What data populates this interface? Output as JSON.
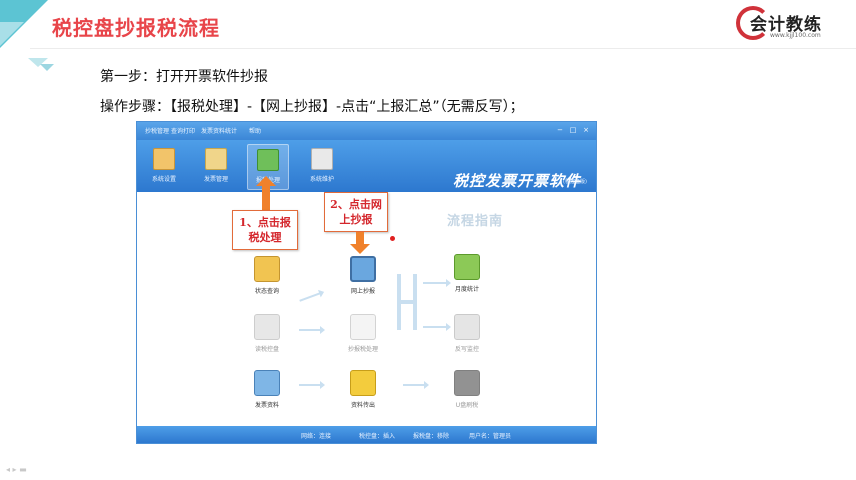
{
  "slide": {
    "title": "税控盘抄报税流程",
    "logo_text": "会计教练",
    "logo_url": "www.kjjl100.com",
    "step1": "第一步：打开开票软件抄报",
    "step2": "操作步骤：【报税处理】-【网上抄报】-点击“上报汇总”（无需反写）；"
  },
  "window": {
    "menu": [
      "抄税管理",
      "查询打印",
      "发票资料统计",
      "帮助"
    ],
    "win_controls": [
      "−",
      "□",
      "×"
    ],
    "toolbar": [
      {
        "label": "系统设置",
        "color": "#f2c46a"
      },
      {
        "label": "发票管理",
        "color": "#f0d58a"
      },
      {
        "label": "报税处理",
        "color": "#6fbf5a"
      },
      {
        "label": "系统维护",
        "color": "#e9e9e9"
      }
    ],
    "brand_title": "税控发票开票软件",
    "brand_sub": "(税控盘版)",
    "guide_title": "流程指南",
    "nodes": {
      "status_query": "状态查询",
      "online_report": "网上抄报",
      "monthly_stats": "月度统计",
      "read_disk": "读税控盘",
      "report_process": "抄报税处理",
      "reverse_write": "反写监控",
      "invoice_data": "发票资料",
      "data_transfer": "资料传出",
      "u_backup": "U盘刷税"
    },
    "status": {
      "network": "网络：连接",
      "tax_disk": "税控盘：插入",
      "report_disk": "报税盘：移除",
      "user": "用户名：管理员"
    }
  },
  "callouts": {
    "first": "1、点击报\n税处理",
    "second": "2、点击网\n上抄报"
  },
  "player_controls": "◂ ▸ ▬"
}
